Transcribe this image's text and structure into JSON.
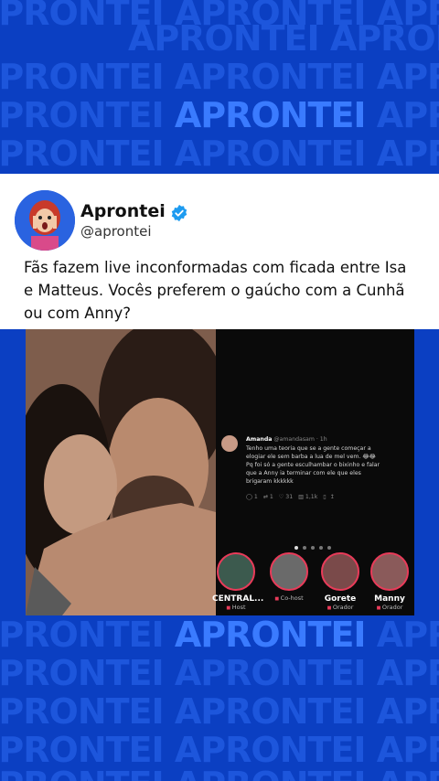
{
  "background": {
    "brand_word": "APRONTEI",
    "color": "#0b3fc2"
  },
  "post": {
    "author_name": "Aprontei",
    "author_handle": "@aprontei",
    "verified": true,
    "text": "Fãs fazem live inconformadas com ficada entre Isa e Matteus. Vocês preferem o gaúcho com a Cunhã ou com Anny?"
  },
  "screenshot": {
    "reply": {
      "author": "Amanda",
      "handle": "@amandasam",
      "time": "1h",
      "lines": [
        "Tenho uma teoria que se a gente começar a",
        "elogiar ele sem barba a lua de mel vem. 😂😂",
        "Pq foi só a gente esculhambar o bixinho e falar",
        "que a Anny ia terminar com ele que eles",
        "brigaram kkkkkk"
      ],
      "stats": {
        "replies": "1",
        "retweets": "1",
        "likes": "31",
        "views": "1,1k"
      }
    },
    "carousel_dots": 5,
    "carousel_active": 1,
    "live_participants": [
      {
        "name": "CENTRAL...",
        "role": "Host"
      },
      {
        "name": "",
        "role": "Co-host"
      },
      {
        "name": "Gorete",
        "role": "Orador"
      },
      {
        "name": "Manny",
        "role": "Orador"
      }
    ]
  },
  "icons": [
    "verified-badge-icon",
    "reply-icon",
    "retweet-icon",
    "like-icon",
    "views-icon",
    "bookmark-icon",
    "share-icon"
  ]
}
